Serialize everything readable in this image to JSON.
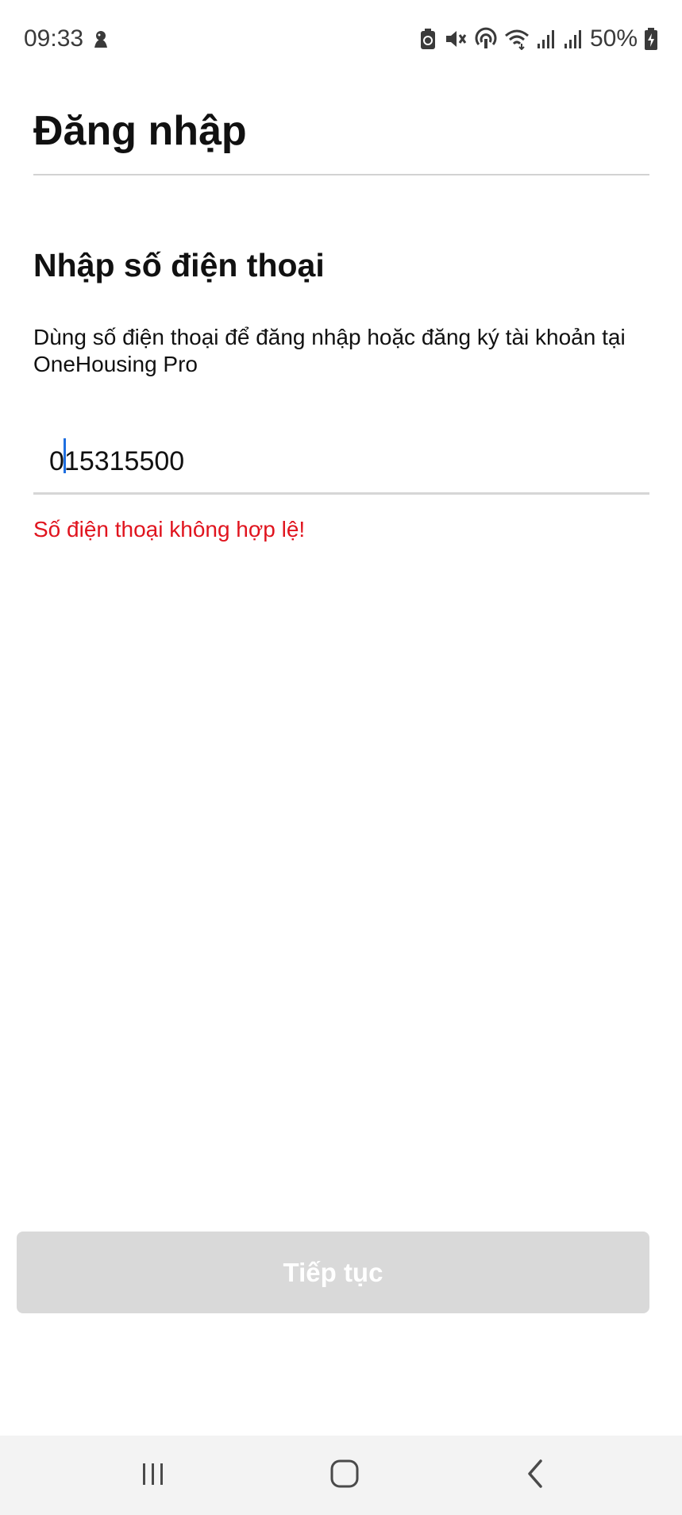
{
  "status_bar": {
    "time": "09:33",
    "battery": "50%",
    "icons": [
      "notification-app-icon",
      "battery-saver-icon",
      "mute-icon",
      "hotspot-icon",
      "wifi-icon",
      "signal-icon",
      "signal-icon",
      "battery-icon"
    ]
  },
  "header": {
    "title": "Đăng nhập"
  },
  "main": {
    "section_title": "Nhập số điện thoại",
    "description": "Dùng số điện thoại để đăng nhập hoặc đăng ký tài khoản tại OneHousing Pro",
    "phone_value": "015315500",
    "error": "Số điện thoại không hợp lệ!"
  },
  "actions": {
    "continue_label": "Tiếp tục"
  },
  "nav_bar": {
    "icons": [
      "recents-icon",
      "home-icon",
      "back-icon"
    ]
  },
  "colors": {
    "error": "#e0141e",
    "caret": "#1f6fe0",
    "button_disabled": "#d9d9d9",
    "divider": "#d2d2d2"
  }
}
